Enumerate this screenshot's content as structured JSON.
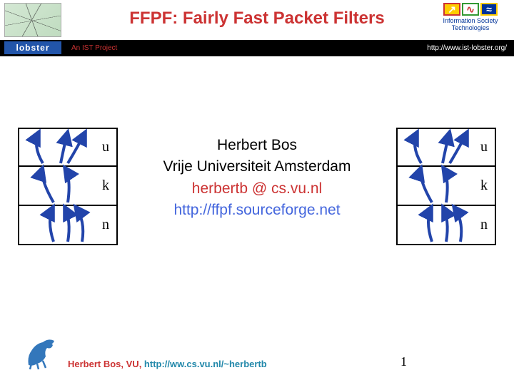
{
  "header": {
    "title": "FFPF: Fairly Fast Packet Filters",
    "ist_label": "Information Society Technologies",
    "ist_icons": [
      "↗",
      "∿",
      "≈"
    ]
  },
  "blackbar": {
    "lobster": "lobster",
    "project_label": "An IST Project",
    "url": "http://www.ist-lobster.org/"
  },
  "diagram": {
    "rows": [
      "u",
      "k",
      "n"
    ]
  },
  "center": {
    "author": "Herbert Bos",
    "affiliation": "Vrije Universiteit Amsterdam",
    "email": "herbertb @ cs.vu.nl",
    "url": "http://ffpf.sourceforge.net"
  },
  "footer": {
    "name": "Herbert Bos, VU, ",
    "url": "http://ww.cs.vu.nl/~herbertb",
    "page": "1"
  }
}
